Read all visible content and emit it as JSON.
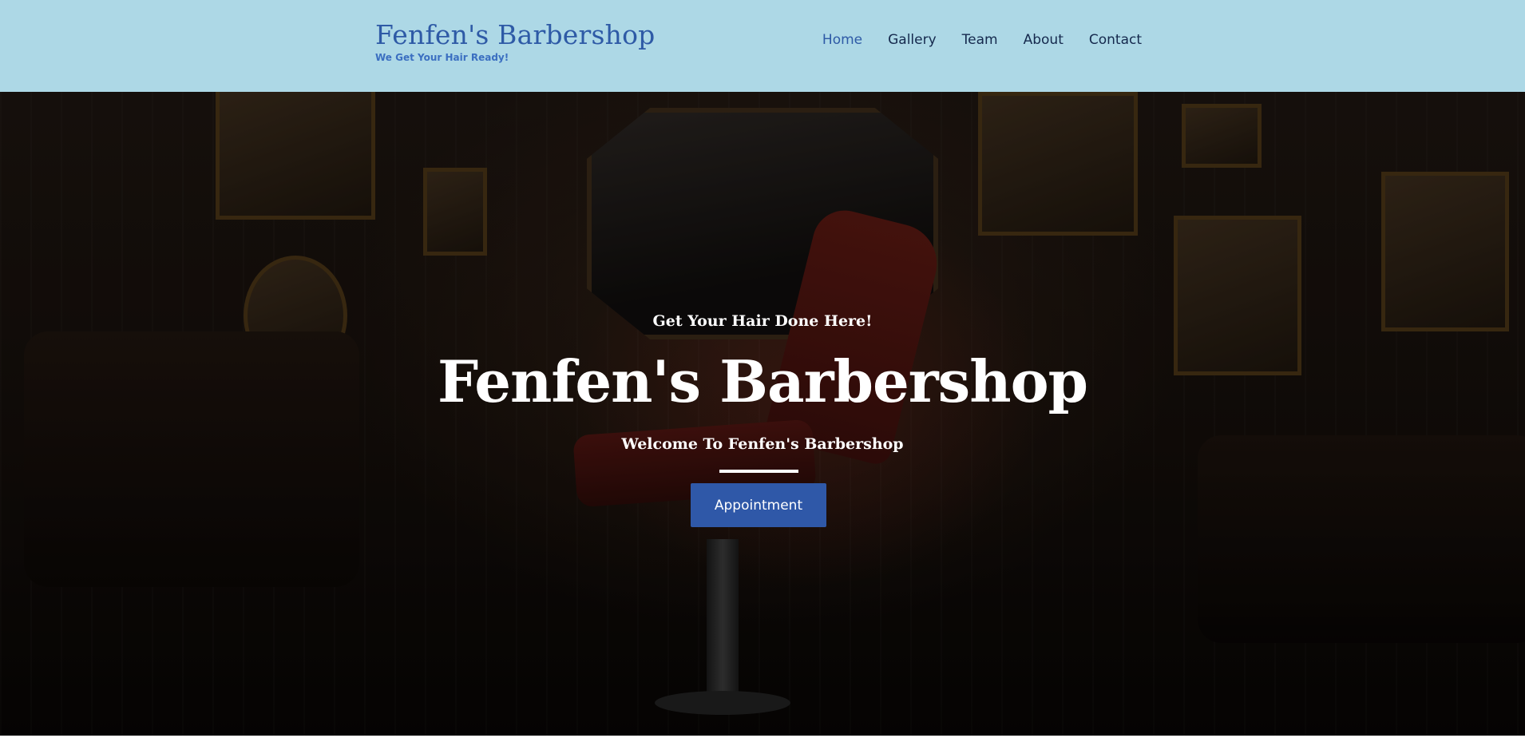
{
  "header": {
    "brand_title": "Fenfen's Barbershop",
    "brand_tagline": "We Get Your Hair Ready!",
    "nav": [
      {
        "label": "Home",
        "active": true
      },
      {
        "label": "Gallery",
        "active": false
      },
      {
        "label": "Team",
        "active": false
      },
      {
        "label": "About",
        "active": false
      },
      {
        "label": "Contact",
        "active": false
      }
    ]
  },
  "hero": {
    "kicker": "Get Your Hair Done Here!",
    "title": "Fenfen's Barbershop",
    "subtitle": "Welcome To Fenfen's Barbershop",
    "cta_label": "Appointment"
  },
  "colors": {
    "header_bg": "#add8e6",
    "brand": "#2e5aa6",
    "nav_text": "#15294d",
    "cta_bg": "#2f58a8",
    "hero_text": "#ffffff"
  }
}
